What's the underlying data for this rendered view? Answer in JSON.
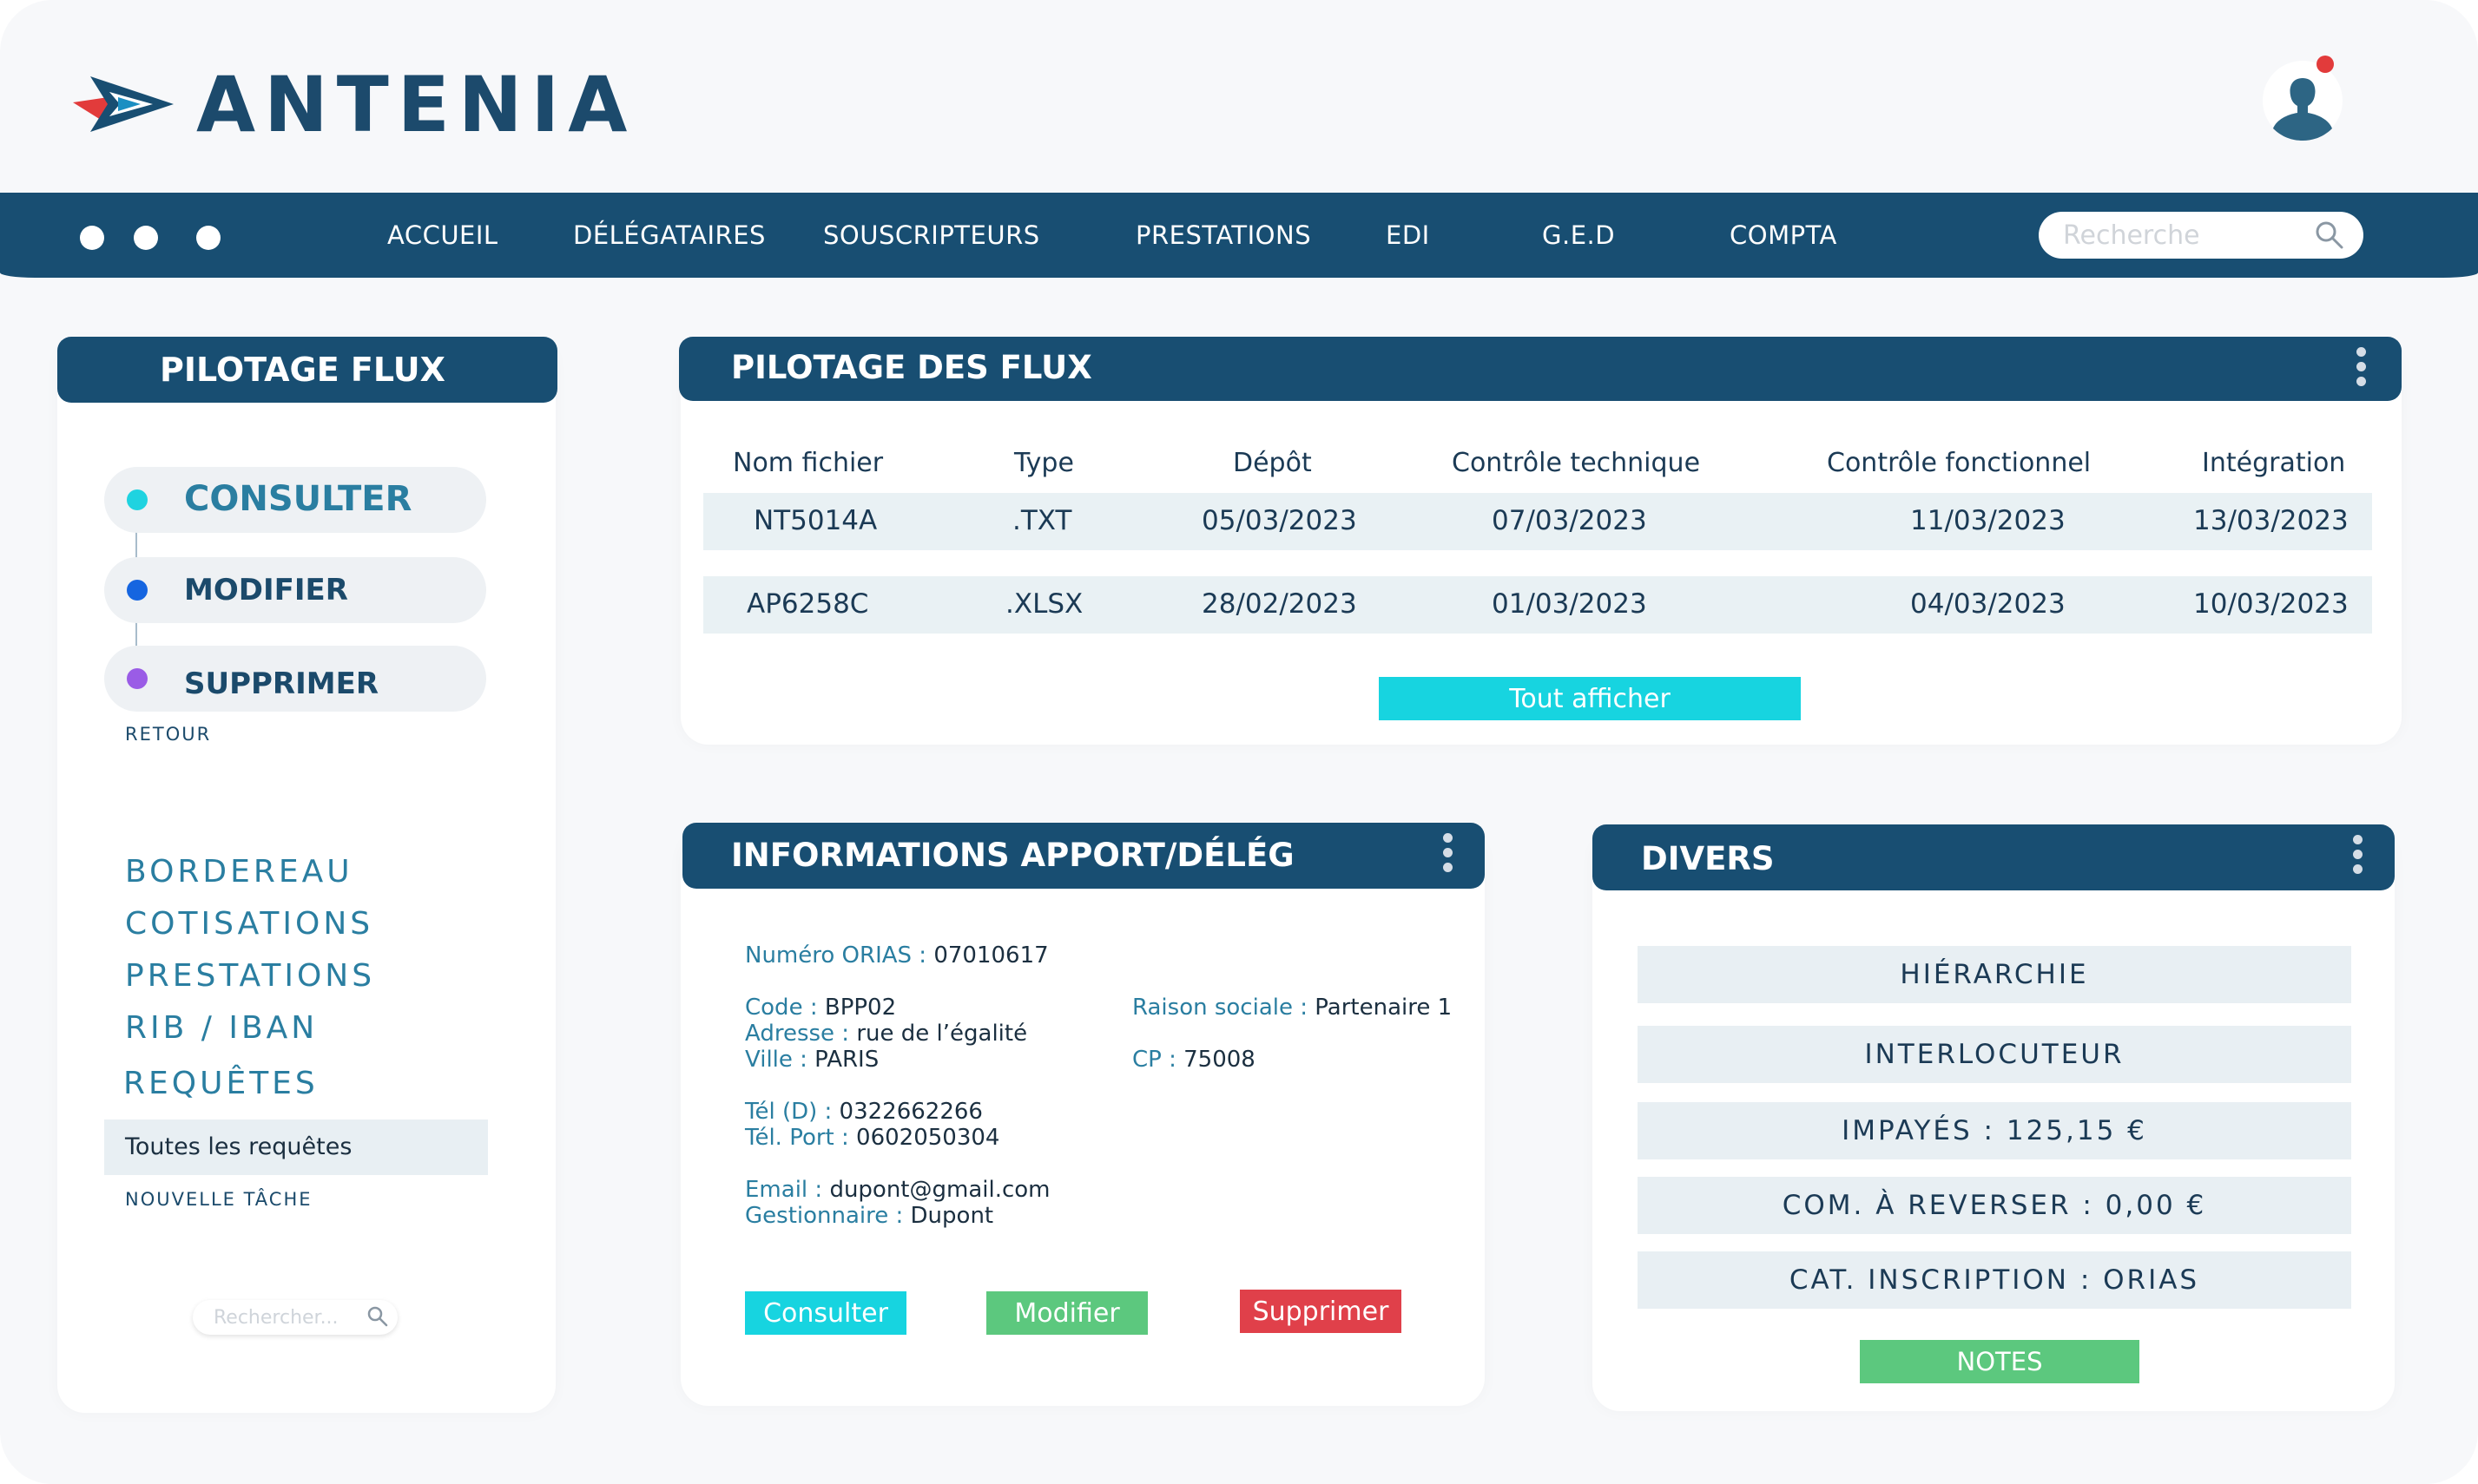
{
  "app": {
    "brand": "ANTENIA"
  },
  "nav": {
    "items": [
      "ACCUEIL",
      "DÉLÉGATAIRES",
      "SOUSCRIPTEURS",
      "PRESTATIONS",
      "EDI",
      "G.E.D",
      "COMPTA"
    ],
    "search_placeholder": "Recherche"
  },
  "left_panel": {
    "title": "PILOTAGE FLUX",
    "steps": [
      {
        "label": "CONSULTER",
        "color": "#1fd3e0"
      },
      {
        "label": "MODIFIER",
        "color": "#1565e0"
      },
      {
        "label": "SUPPRIMER",
        "color": "#9a5ce6"
      }
    ],
    "back_label": "RETOUR",
    "menu": [
      "BORDEREAU",
      "COTISATIONS",
      "PRESTATIONS",
      "RIB / IBAN",
      "REQUÊTES"
    ],
    "selected_item": "Toutes les requêtes",
    "new_task_label": "NOUVELLE TÂCHE",
    "search_placeholder": "Rechercher..."
  },
  "flux_panel": {
    "title": "PILOTAGE DES FLUX",
    "columns": [
      "Nom fichier",
      "Type",
      "Dépôt",
      "Contrôle technique",
      "Contrôle fonctionnel",
      "Intégration"
    ],
    "rows": [
      [
        "NT5014A",
        ".TXT",
        "05/03/2023",
        "07/03/2023",
        "11/03/2023",
        "13/03/2023"
      ],
      [
        "AP6258C",
        ".XLSX",
        "28/02/2023",
        "01/03/2023",
        "04/03/2023",
        "10/03/2023"
      ]
    ],
    "show_all_label": "Tout afficher"
  },
  "info_panel": {
    "title": "INFORMATIONS APPORT/DÉLÉG",
    "orias": {
      "k": "Numéro ORIAS : ",
      "v": "07010617"
    },
    "code": {
      "k": "Code : ",
      "v": "BPP02"
    },
    "adresse": {
      "k": "Adresse : ",
      "v": "rue de l’égalité"
    },
    "ville": {
      "k": "Ville : ",
      "v": "PARIS"
    },
    "raison": {
      "k": "Raison sociale : ",
      "v": "Partenaire 1"
    },
    "cp": {
      "k": "CP : ",
      "v": "75008"
    },
    "tel": {
      "k": "Tél (D) : ",
      "v": "0322662266"
    },
    "port": {
      "k": "Tél. Port : ",
      "v": "0602050304"
    },
    "email": {
      "k": "Email : ",
      "v": "dupont@gmail.com"
    },
    "gestionnaire": {
      "k": "Gestionnaire : ",
      "v": "Dupont"
    },
    "buttons": {
      "consult": "Consulter",
      "modify": "Modifier",
      "delete": "Supprimer"
    }
  },
  "divers_panel": {
    "title": "DIVERS",
    "rows": [
      "HIÉRARCHIE",
      "INTERLOCUTEUR",
      "IMPAYÉS : 125,15 €",
      "COM. À REVERSER : 0,00 €",
      "CAT. INSCRIPTION : ORIAS"
    ],
    "notes_label": "NOTES"
  },
  "colors": {
    "primary": "#184e72",
    "cyan": "#17d4e0",
    "green": "#5cc87e",
    "red": "#e0404a"
  }
}
